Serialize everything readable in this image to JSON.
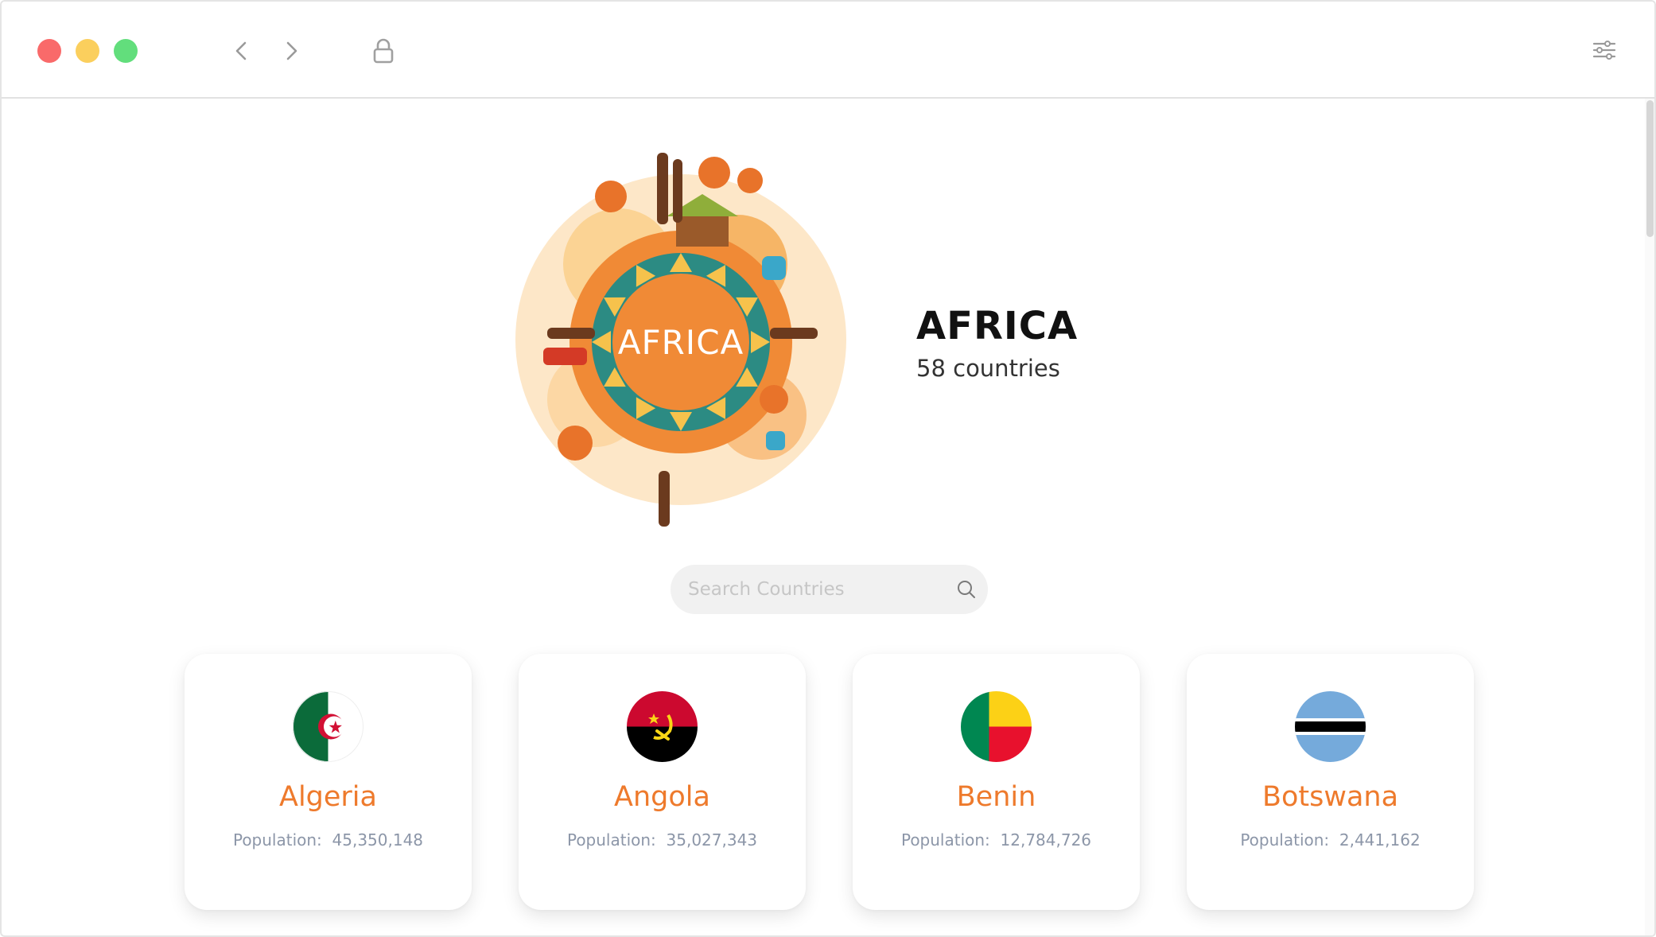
{
  "window": {
    "controls": [
      "close",
      "minimize",
      "maximize"
    ],
    "icons": {
      "back": "chevron-left-icon",
      "forward": "chevron-right-icon",
      "lock": "lock-icon",
      "settings": "sliders-icon"
    }
  },
  "hero": {
    "art_label": "AFRICA",
    "title": "AFRICA",
    "subtitle": "58 countries"
  },
  "search": {
    "placeholder": "Search Countries",
    "value": ""
  },
  "countries": [
    {
      "name": "Algeria",
      "population_label": "Population:",
      "population": "45,350,148",
      "flag": "algeria-flag"
    },
    {
      "name": "Angola",
      "population_label": "Population:",
      "population": "35,027,343",
      "flag": "angola-flag"
    },
    {
      "name": "Benin",
      "population_label": "Population:",
      "population": "12,784,726",
      "flag": "benin-flag"
    },
    {
      "name": "Botswana",
      "population_label": "Population:",
      "population": "2,441,162",
      "flag": "botswana-flag"
    }
  ],
  "colors": {
    "accent": "#ee7a2c",
    "close": "#f96a6a",
    "minimize": "#fbcf5d",
    "maximize": "#62de7c",
    "search_bg": "#f1f1f1"
  }
}
